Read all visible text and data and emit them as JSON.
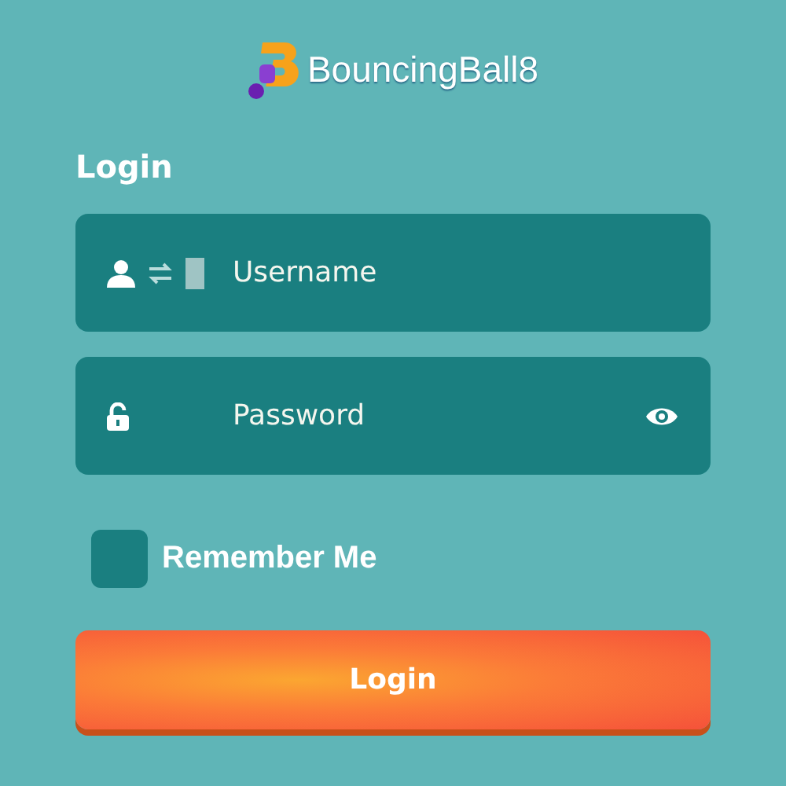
{
  "logo": {
    "text": "BouncingBall8"
  },
  "heading": "Login",
  "fields": [
    {
      "kind": "username",
      "placeholder": "Username"
    },
    {
      "kind": "password",
      "placeholder": "Password"
    }
  ],
  "remember": {
    "label": "Remember Me",
    "checked": false
  },
  "submit": {
    "label": "Login"
  }
}
